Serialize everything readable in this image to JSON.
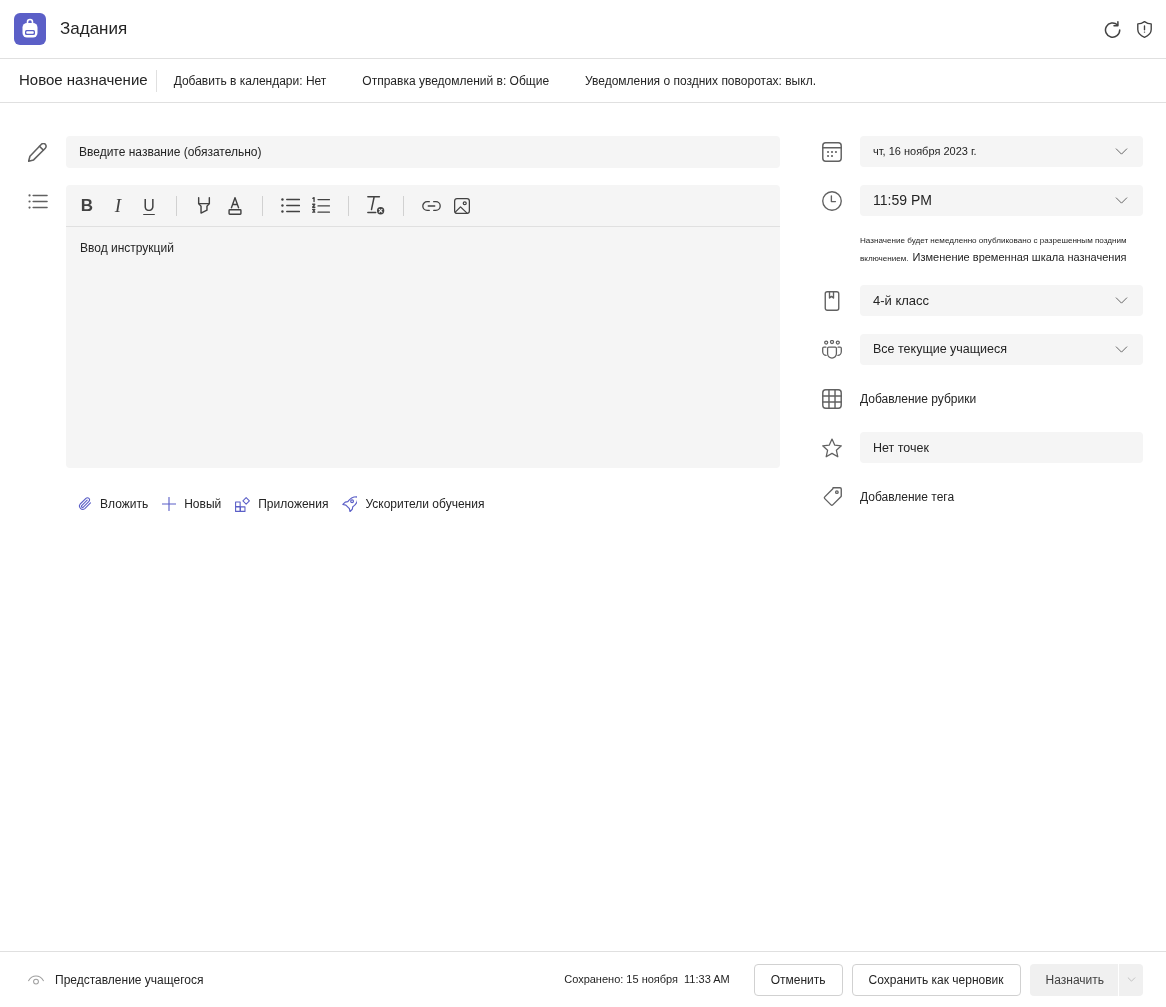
{
  "app": {
    "title": "Задания"
  },
  "command_bar": {
    "title": "Новое назначение",
    "settings": [
      "Добавить в календари: Нет",
      "Отправка уведомлений в: Общие",
      "Уведомления о поздних поворотах: выкл."
    ]
  },
  "title_field": {
    "placeholder": "Введите название (обязательно)"
  },
  "editor": {
    "format_groups": [
      [
        {
          "kind": "bold",
          "label": "B"
        },
        {
          "kind": "italic",
          "label": "I"
        },
        {
          "kind": "underline",
          "label": "U"
        }
      ],
      [
        {
          "kind": "highlight"
        },
        {
          "kind": "font_color"
        }
      ],
      [
        {
          "kind": "bullets"
        },
        {
          "kind": "numbering"
        }
      ],
      [
        {
          "kind": "clear_format"
        }
      ],
      [
        {
          "kind": "link"
        },
        {
          "kind": "image"
        }
      ]
    ],
    "placeholder": "Ввод инструкций"
  },
  "attach_actions": [
    {
      "kind": "attach",
      "label": "Вложить"
    },
    {
      "kind": "new",
      "label": "Новый"
    },
    {
      "kind": "apps",
      "label": "Приложения"
    },
    {
      "kind": "accelerators",
      "label": "Ускорители обучения"
    }
  ],
  "details": [
    {
      "kind": "date",
      "value": "чт, 16 ноября 2023 г."
    },
    {
      "kind": "time",
      "value": "11:59 PM"
    },
    {
      "kind": "notice",
      "text": "Назначение будет немедленно опубликовано с разрешенным поздним включением.",
      "link": "Изменение временная шкала назначения"
    },
    {
      "kind": "category",
      "value": "4-й класс"
    },
    {
      "kind": "students",
      "value": "Все текущие учащиеся"
    },
    {
      "kind": "rubric",
      "label": "Добавление рубрики"
    },
    {
      "kind": "points",
      "placeholder": "Нет точек"
    },
    {
      "kind": "tag",
      "label": "Добавление тега"
    }
  ],
  "footer": {
    "student_view": "Представление учащегося",
    "saved": "Сохранено: 15 ноября",
    "saved_time": "11:33 AM",
    "buttons": [
      {
        "kind": "plain",
        "label": "Отменить",
        "disabled": false
      },
      {
        "kind": "plain",
        "label": "Сохранить как черновик",
        "disabled": false
      },
      {
        "kind": "split",
        "label": "Назначить",
        "disabled": true
      }
    ]
  }
}
